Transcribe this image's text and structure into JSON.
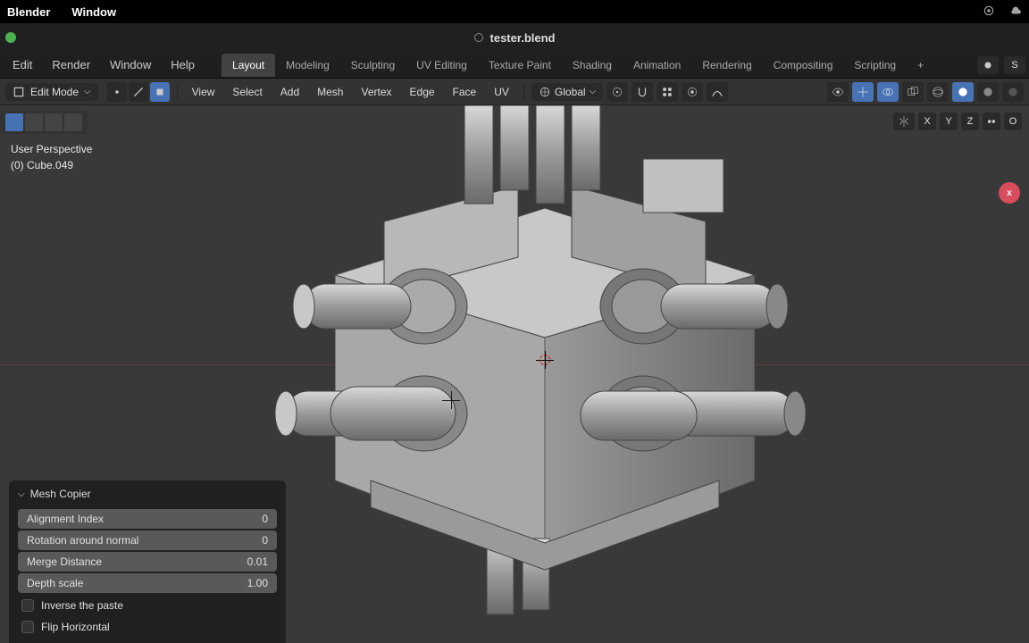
{
  "os_bar": {
    "app_name": "Blender",
    "window_menu": "Window"
  },
  "title_bar": {
    "filename": "tester.blend"
  },
  "main_menu": {
    "items": [
      "Edit",
      "Render",
      "Window",
      "Help"
    ]
  },
  "workspace_tabs": {
    "items": [
      "Layout",
      "Modeling",
      "Sculpting",
      "UV Editing",
      "Texture Paint",
      "Shading",
      "Animation",
      "Rendering",
      "Compositing",
      "Scripting"
    ],
    "active": "Layout",
    "add_label": "+"
  },
  "mode_selector": {
    "label": "Edit Mode"
  },
  "edit_menus": {
    "items": [
      "View",
      "Select",
      "Add",
      "Mesh",
      "Vertex",
      "Edge",
      "Face",
      "UV"
    ]
  },
  "orientation": {
    "label": "Global"
  },
  "axis_toggles": {
    "x": "X",
    "y": "Y",
    "z": "Z",
    "overlay": "O"
  },
  "viewport_info": {
    "line1": "User Perspective",
    "line2": "(0) Cube.049"
  },
  "operator_panel": {
    "title": "Mesh Copier",
    "props": [
      {
        "label": "Alignment Index",
        "value": "0"
      },
      {
        "label": "Rotation around normal",
        "value": "0"
      },
      {
        "label": "Merge Distance",
        "value": "0.01"
      },
      {
        "label": "Depth scale",
        "value": "1.00"
      }
    ],
    "checks": [
      {
        "label": "Inverse the paste"
      },
      {
        "label": "Flip Horizontal"
      }
    ]
  },
  "gizmo": {
    "x_label": "x"
  },
  "top_right": {
    "scene_label": "S"
  }
}
